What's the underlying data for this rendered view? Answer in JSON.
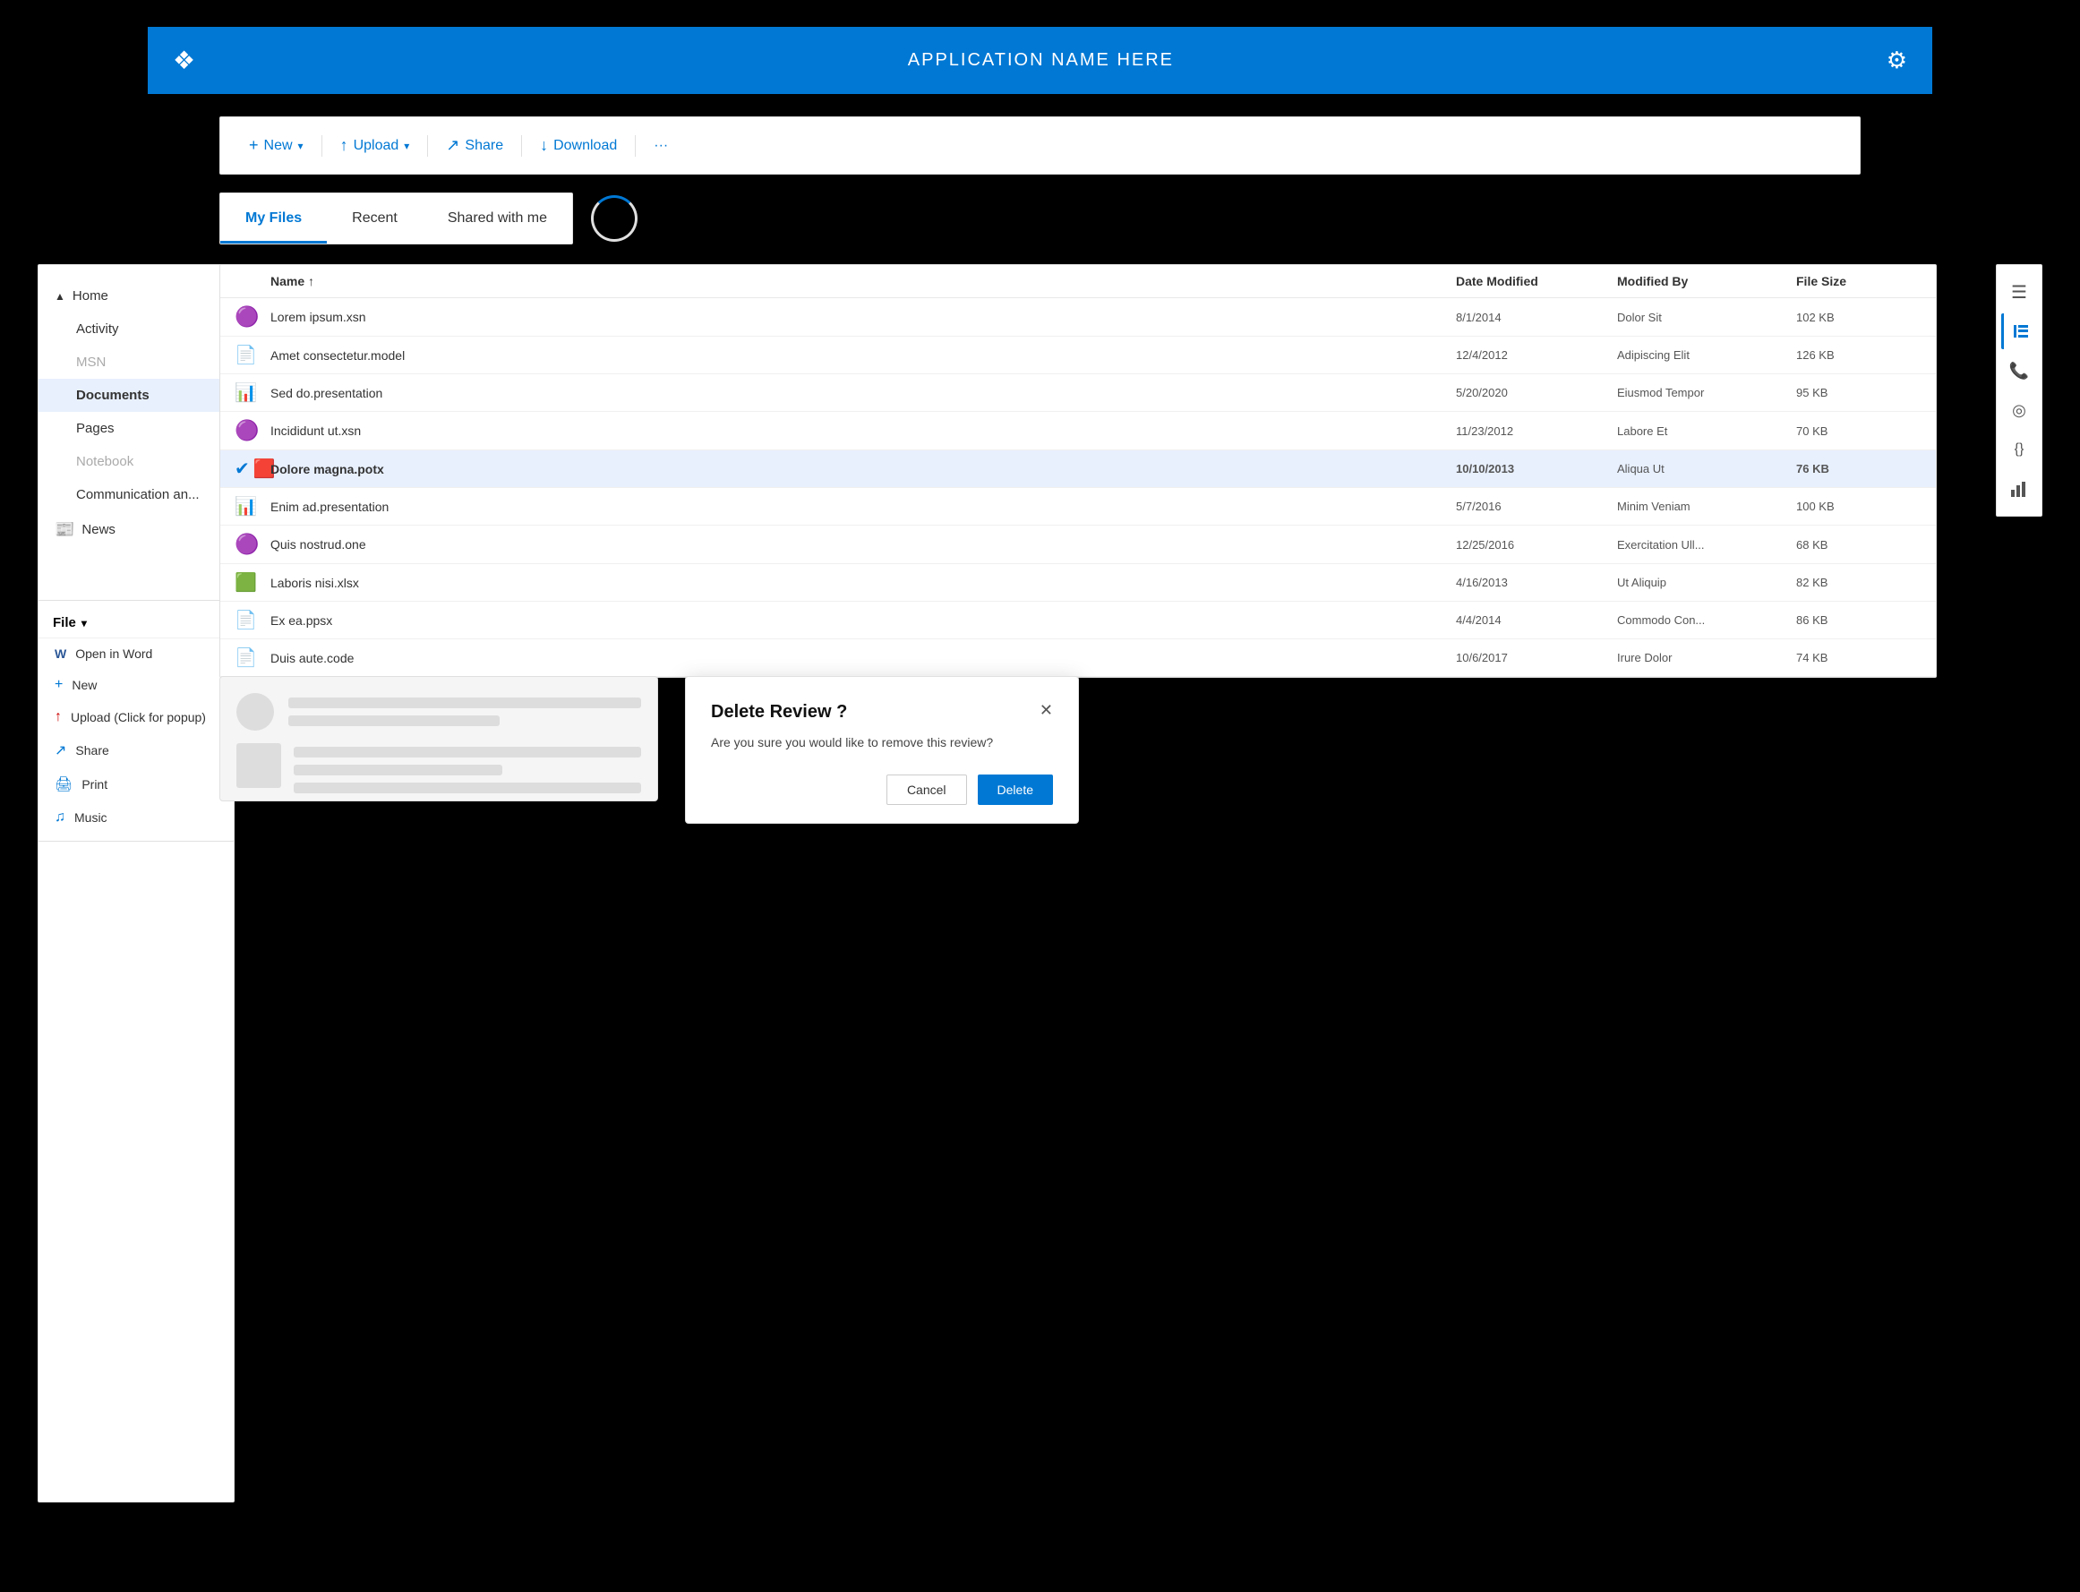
{
  "app": {
    "title": "APPLICATION NAME HERE",
    "logo_icon": "❖",
    "gear_icon": "⚙"
  },
  "toolbar": {
    "buttons": [
      {
        "id": "new",
        "icon": "+",
        "label": "New",
        "has_dropdown": true
      },
      {
        "id": "upload",
        "icon": "↑",
        "label": "Upload",
        "has_dropdown": true
      },
      {
        "id": "share",
        "icon": "↗",
        "label": "Share",
        "has_dropdown": false
      },
      {
        "id": "download",
        "icon": "↓",
        "label": "Download",
        "has_dropdown": false
      },
      {
        "id": "more",
        "icon": "···",
        "label": "",
        "has_dropdown": false
      }
    ]
  },
  "tabs": {
    "items": [
      {
        "id": "my-files",
        "label": "My Files",
        "active": true
      },
      {
        "id": "recent",
        "label": "Recent",
        "active": false
      },
      {
        "id": "shared",
        "label": "Shared with me",
        "active": false
      }
    ]
  },
  "sidebar": {
    "home_label": "Home",
    "items": [
      {
        "id": "activity",
        "label": "Activity",
        "active": false,
        "muted": false
      },
      {
        "id": "msn",
        "label": "MSN",
        "active": false,
        "muted": true
      },
      {
        "id": "documents",
        "label": "Documents",
        "active": true,
        "muted": false
      },
      {
        "id": "pages",
        "label": "Pages",
        "active": false,
        "muted": false
      },
      {
        "id": "notebook",
        "label": "Notebook",
        "active": false,
        "muted": true
      },
      {
        "id": "communication",
        "label": "Communication an...",
        "active": false,
        "muted": false
      }
    ],
    "news_label": "News",
    "news_icon": "📰"
  },
  "file_menu": {
    "header": "File",
    "items": [
      {
        "id": "open-word",
        "icon": "W",
        "label": "Open in Word"
      },
      {
        "id": "new",
        "icon": "+",
        "label": "New"
      },
      {
        "id": "upload",
        "icon": "↑",
        "label": "Upload (Click for popup)"
      },
      {
        "id": "share",
        "icon": "↗",
        "label": "Share"
      },
      {
        "id": "print",
        "icon": "🖨",
        "label": "Print"
      },
      {
        "id": "music",
        "icon": "♫",
        "label": "Music"
      }
    ]
  },
  "file_list": {
    "columns": {
      "name": "Name ↑",
      "date_modified": "Date Modified",
      "modified_by": "Modified By",
      "file_size": "File Size"
    },
    "files": [
      {
        "id": 1,
        "icon": "🟣",
        "icon_color": "#7b2c9e",
        "name": "Lorem ipsum.xsn",
        "date": "8/1/2014",
        "modified_by": "Dolor Sit",
        "size": "102 KB",
        "selected": false,
        "type": "xsn"
      },
      {
        "id": 2,
        "icon": "📄",
        "icon_color": "#aaa",
        "name": "Amet consectetur.model",
        "date": "12/4/2012",
        "modified_by": "Adipiscing Elit",
        "size": "126 KB",
        "selected": false,
        "type": "model"
      },
      {
        "id": 3,
        "icon": "📊",
        "icon_color": "#aaa",
        "name": "Sed do.presentation",
        "date": "5/20/2020",
        "modified_by": "Eiusmod Tempor",
        "size": "95 KB",
        "selected": false,
        "type": "presentation"
      },
      {
        "id": 4,
        "icon": "🟣",
        "icon_color": "#7b2c9e",
        "name": "Incididunt ut.xsn",
        "date": "11/23/2012",
        "modified_by": "Labore Et",
        "size": "70 KB",
        "selected": false,
        "type": "xsn"
      },
      {
        "id": 5,
        "icon": "🟥",
        "icon_color": "#c00",
        "name": "Dolore magna.potx",
        "date": "10/10/2013",
        "modified_by": "Aliqua Ut",
        "size": "76 KB",
        "selected": true,
        "type": "potx"
      },
      {
        "id": 6,
        "icon": "📊",
        "icon_color": "#aaa",
        "name": "Enim ad.presentation",
        "date": "5/7/2016",
        "modified_by": "Minim Veniam",
        "size": "100 KB",
        "selected": false,
        "type": "presentation"
      },
      {
        "id": 7,
        "icon": "🟣",
        "icon_color": "#7b2c9e",
        "name": "Quis nostrud.one",
        "date": "12/25/2016",
        "modified_by": "Exercitation Ull...",
        "size": "68 KB",
        "selected": false,
        "type": "one"
      },
      {
        "id": 8,
        "icon": "🟩",
        "icon_color": "#217346",
        "name": "Laboris nisi.xlsx",
        "date": "4/16/2013",
        "modified_by": "Ut Aliquip",
        "size": "82 KB",
        "selected": false,
        "type": "xlsx"
      },
      {
        "id": 9,
        "icon": "📄",
        "icon_color": "#aaa",
        "name": "Ex ea.ppsx",
        "date": "4/4/2014",
        "modified_by": "Commodo Con...",
        "size": "86 KB",
        "selected": false,
        "type": "ppsx"
      },
      {
        "id": 10,
        "icon": "📄",
        "icon_color": "#aaa",
        "name": "Duis aute.code",
        "date": "10/6/2017",
        "modified_by": "Irure Dolor",
        "size": "74 KB",
        "selected": false,
        "type": "code"
      }
    ]
  },
  "delete_dialog": {
    "title": "Delete Review ?",
    "body": "Are you sure you would like to remove this review?",
    "cancel_label": "Cancel",
    "delete_label": "Delete",
    "close_icon": "✕"
  },
  "right_icons": [
    {
      "id": "menu",
      "icon": "☰",
      "active": false
    },
    {
      "id": "list",
      "icon": "≡",
      "active": true
    },
    {
      "id": "phone",
      "icon": "📞",
      "active": false
    },
    {
      "id": "signal",
      "icon": "◎",
      "active": false
    },
    {
      "id": "code",
      "icon": "{}",
      "active": false
    },
    {
      "id": "chart",
      "icon": "📊",
      "active": false
    }
  ]
}
